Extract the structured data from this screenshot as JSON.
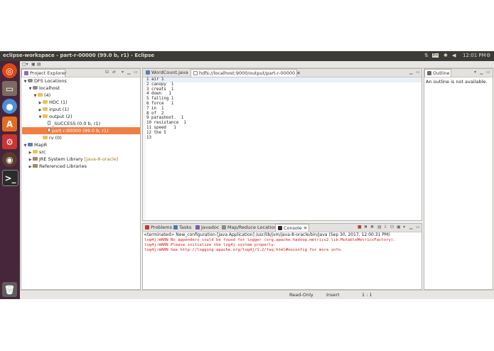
{
  "topbar": {
    "title": "eclipse-workspace - part-r-00000 (99.0 b, r1) - Eclipse",
    "clock": "12:01 PM",
    "keyboard": "En"
  },
  "project_explorer": {
    "tab_label": "Project Explorer",
    "items": [
      {
        "label": "DFS Locations"
      },
      {
        "label": "localhost"
      },
      {
        "label": "(4)"
      },
      {
        "label": "HDC (1)"
      },
      {
        "label": "input (1)"
      },
      {
        "label": "output (2)"
      },
      {
        "label": "_SUCCESS (0.0 b, r1)"
      },
      {
        "label": "part-r-00000 (99.0 b, r1)"
      },
      {
        "label": "rv (0)"
      },
      {
        "label": "MapR"
      },
      {
        "label": "src"
      },
      {
        "label": "JRE System Library",
        "suffix": "[java-8-oracle]"
      },
      {
        "label": "Referenced Libraries"
      }
    ]
  },
  "editor": {
    "tabs": [
      {
        "label": "WordCount.java"
      },
      {
        "label": "hdfs://localhost:9000/output/part-r-00000"
      }
    ],
    "lines": [
      "1 air 1",
      "2 canopy  1",
      "3 creats  1",
      "4 down   1",
      "5 falling 1",
      "6 force   1",
      "7 in  1",
      "8 of  2",
      "9 parashoot.  1",
      "10 resistance  1",
      "11 speed   1",
      "12 the 5",
      "13"
    ]
  },
  "outline": {
    "tab_label": "Outline",
    "message": "An outline is not available."
  },
  "console": {
    "tabs": [
      {
        "label": "Problems"
      },
      {
        "label": "Tasks"
      },
      {
        "label": "Javadoc"
      },
      {
        "label": "Map/Reduce Locations"
      },
      {
        "label": "Console"
      }
    ],
    "header": "<terminated> New_configuration [Java Application] /usr/lib/jvm/java-8-oracle/bin/java (Sep 30, 2017, 12:00:31 PM)",
    "lines": [
      "log4j:WARN No appenders could be found for logger (org.apache.hadoop.metrics2.lib.MutableMetricsFactory).",
      "log4j:WARN Please initialize the log4j system properly.",
      "log4j:WARN See http://logging.apache.org/log4j/1.2/faq.html#noconfig for more info."
    ]
  },
  "status": {
    "mode": "Read-Only",
    "insert": "Insert",
    "position": "1 : 1"
  }
}
